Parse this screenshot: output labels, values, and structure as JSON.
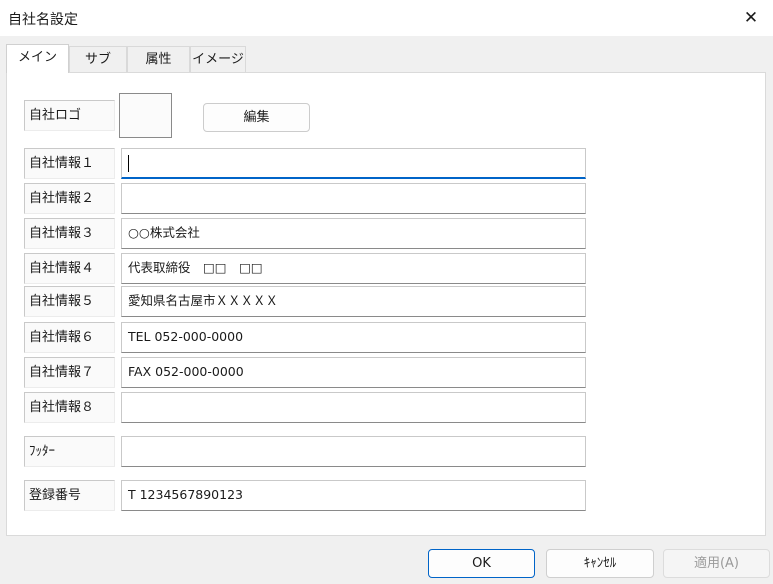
{
  "window": {
    "title": "自社名設定",
    "close_glyph": "✕"
  },
  "tabs": [
    {
      "label": "メイン",
      "active": true
    },
    {
      "label": "サブ"
    },
    {
      "label": "属性"
    },
    {
      "label": "イメージ"
    }
  ],
  "logo": {
    "label": "自社ロゴ",
    "edit_button": "編集"
  },
  "fields": [
    {
      "label": "自社情報１",
      "value": ""
    },
    {
      "label": "自社情報２",
      "value": ""
    },
    {
      "label": "自社情報３",
      "value": "○○株式会社"
    },
    {
      "label": "自社情報４",
      "value": "代表取締役　□□　□□"
    },
    {
      "label": "自社情報５",
      "value": "愛知県名古屋市ＸＸＸＸＸ"
    },
    {
      "label": "自社情報６",
      "value": "TEL 052-000-0000"
    },
    {
      "label": "自社情報７",
      "value": "FAX 052-000-0000"
    },
    {
      "label": "自社情報８",
      "value": ""
    },
    {
      "label": "ﾌｯﾀｰ",
      "value": ""
    },
    {
      "label": "登録番号",
      "value": "T 1234567890123"
    }
  ],
  "buttons": {
    "ok": "OK",
    "cancel": "ｷｬﾝｾﾙ",
    "apply": "適用(A)"
  },
  "colors": {
    "accent": "#0064c8",
    "disabled_text": "#9a9a9a"
  }
}
